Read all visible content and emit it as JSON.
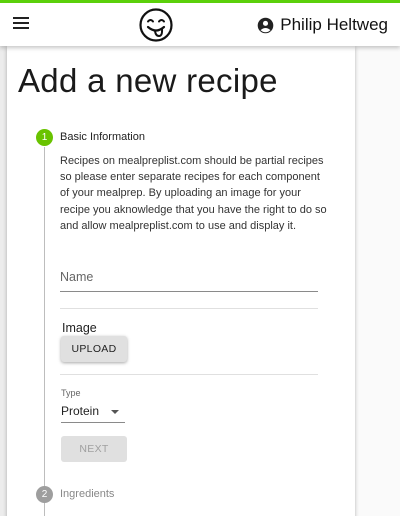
{
  "header": {
    "menu_icon": "hamburger-menu-icon",
    "logo_icon": "yum-face-icon",
    "user_icon": "account-circle-icon",
    "user_name": "Philip Heltweg",
    "accent_color": "#5bd00a"
  },
  "page": {
    "title": "Add a new recipe"
  },
  "stepper": {
    "active_color": "#69c300",
    "inactive_color": "#9e9e9e",
    "steps": [
      {
        "number": "1",
        "label": "Basic Information"
      },
      {
        "number": "2",
        "label": "Ingredients"
      }
    ]
  },
  "form": {
    "intro": "Recipes on mealpreplist.com should be partial recipes so please enter separate recipes for each component of your mealprep. By uploading an image for your recipe you aknowledge that you have the right to do so and allow mealpreplist.com to use and display it.",
    "name_label": "Name",
    "name_value": "",
    "image_label": "Image",
    "upload_label": "UPLOAD",
    "type_label": "Type",
    "type_value": "Protein",
    "next_label": "NEXT"
  }
}
